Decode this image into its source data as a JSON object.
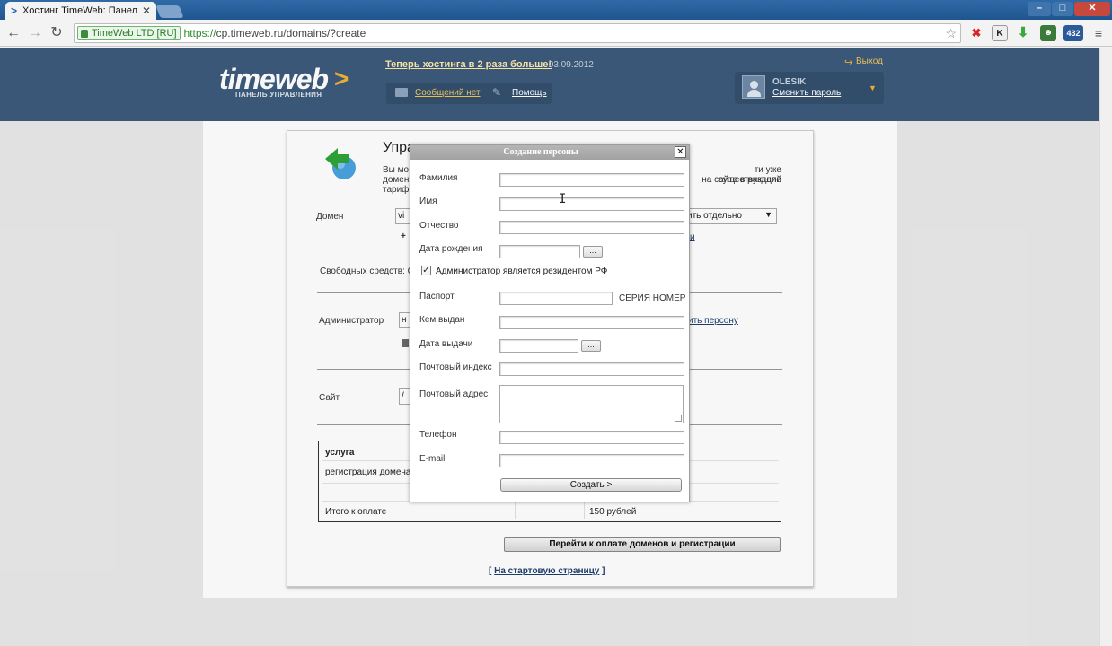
{
  "browser": {
    "tab_title": "Хостинг TimeWeb: Панел",
    "tab_close": "✕",
    "ev_badge": "TimeWeb LTD [RU]",
    "url_scheme": "https://",
    "url_rest": "cp.timeweb.ru/domains/?create",
    "ext_icons": [
      "stop-icon",
      "k-icon",
      "download-icon",
      "robot-icon",
      "counter-icon"
    ],
    "ext_counter": "432"
  },
  "header": {
    "logo": "timeweb",
    "logo_arrow": ">",
    "logo_sub": "ПАНЕЛЬ УПРАВЛЕНИЯ",
    "news_text": "Теперь хостинга в 2 раза больше!",
    "news_date": "— 03.09.2012",
    "messages": "Сообщений нет",
    "help": "Помощь",
    "logout": "Выход",
    "username": "OLESIK",
    "change_password": "Сменить пароль"
  },
  "page": {
    "title_partial": "Упра",
    "intro_left": [
      "Вы мо",
      "домен",
      "тариф"
    ],
    "intro_right": [
      "ти уже существующий",
      "на сайте в разделе"
    ],
    "domain_label": "Домен",
    "domain_input_partial": "vi",
    "domain_select_partial": "ить отдельно",
    "domain_link_partial": "и",
    "funds_label_partial": "Свободных средств: С",
    "admin_label": "Администратор",
    "admin_select_partial": "н",
    "admin_link_partial": "ить персону",
    "site_label": "Сайт",
    "site_input_partial": "/",
    "table": {
      "header": "услуга",
      "row1": "регистрация домена",
      "total_label": "Итого к оплате",
      "total_value": "150 рублей"
    },
    "pay_button": "Перейти к оплате доменов и регистрации",
    "home_link": "На стартовую страницу",
    "home_open": "[",
    "home_close": "]"
  },
  "dialog": {
    "title": "Создание персоны",
    "close": "✕",
    "fields": {
      "last_name": "Фамилия",
      "first_name": "Имя",
      "patronymic": "Отчество",
      "birth_date": "Дата рождения",
      "passport": "Паспорт",
      "issued_by": "Кем выдан",
      "issue_date": "Дата выдачи",
      "postal_code": "Почтовый индекс",
      "postal_address": "Почтовый адрес",
      "phone": "Телефон",
      "email": "E-mail"
    },
    "calendar_button": "...",
    "resident_label": "Администратор является резидентом РФ",
    "resident_checked": true,
    "passport_hint": "СЕРИЯ НОМЕР",
    "submit": "Создать >"
  },
  "colors": {
    "header_bg": "#3c5a7c",
    "accent": "#f2b233",
    "link": "#1d3f6e"
  }
}
